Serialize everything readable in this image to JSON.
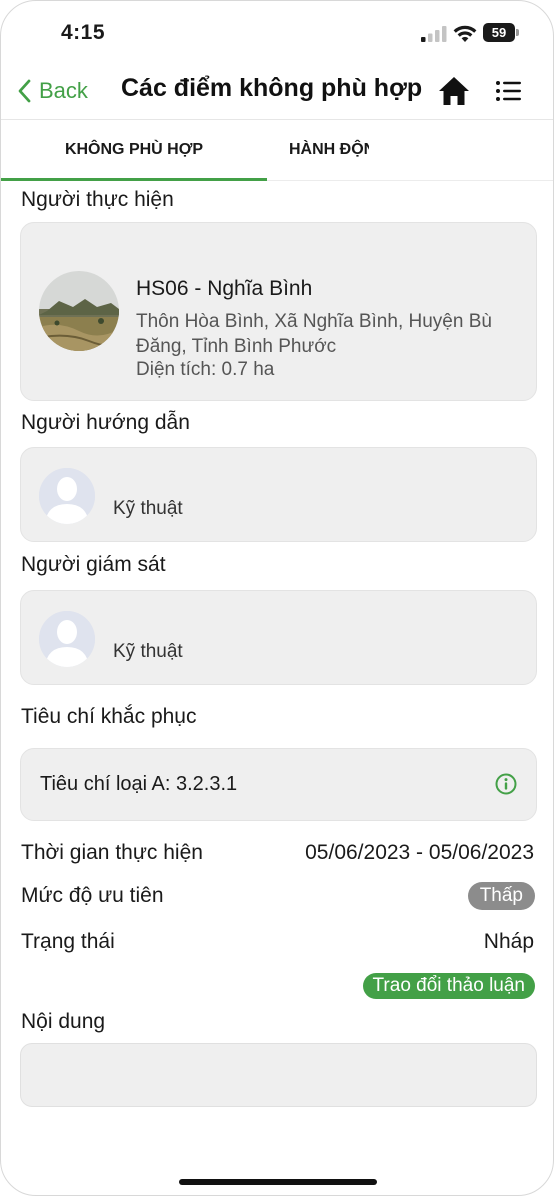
{
  "status_bar": {
    "time": "4:15",
    "battery": "59"
  },
  "header": {
    "back_label": "Back",
    "title": "Các điểm không phù hợp"
  },
  "tabs": [
    {
      "label": "KHÔNG PHÙ HỢP",
      "active": true
    },
    {
      "label": "HÀNH ĐỘNG",
      "active": false
    }
  ],
  "performer": {
    "label": "Người thực hiện",
    "name": "HS06 - Nghĩa Bình",
    "address": "Thôn Hòa Bình, Xã Nghĩa Bình, Huyện Bù Đăng, Tỉnh Bình Phước",
    "area": "Diện tích: 0.7 ha"
  },
  "instructor": {
    "label": "Người hướng dẫn",
    "role": "Kỹ thuật"
  },
  "supervisor": {
    "label": "Người giám sát",
    "role": "Kỹ thuật"
  },
  "criteria": {
    "label": "Tiêu chí khắc phục",
    "value": "Tiêu chí loại A: 3.2.3.1"
  },
  "details": {
    "time_label": "Thời gian thực hiện",
    "time_value": "05/06/2023 - 05/06/2023",
    "priority_label": "Mức độ ưu tiên",
    "priority_value": "Thấp",
    "status_label": "Trạng thái",
    "status_value": "Nháp",
    "discuss_button": "Trao đổi thảo luận"
  },
  "content": {
    "label": "Nội dung",
    "value": ""
  },
  "colors": {
    "accent": "#43a047",
    "badge_gray": "#8c8c8c",
    "card_bg": "#efefef"
  },
  "icons": [
    "chevron-left-icon",
    "home-icon",
    "list-icon",
    "info-icon",
    "signal-icon",
    "wifi-icon",
    "battery-icon"
  ]
}
